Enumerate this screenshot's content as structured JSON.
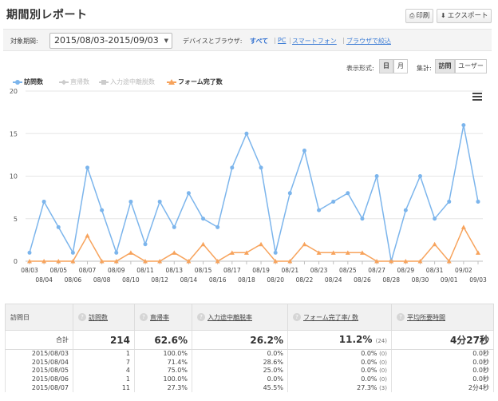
{
  "header": {
    "title": "期間別レポート",
    "print_label": "印刷",
    "export_label": "エクスポート"
  },
  "filter": {
    "period_label": "対象期間:",
    "period_value": "2015/08/03-2015/09/03",
    "device_label": "デバイスとブラウザ:",
    "device_links": [
      "すべて",
      "PC",
      "スマートフォン",
      "ブラウザで絞込"
    ],
    "device_active": "すべて"
  },
  "controls": {
    "display_label": "表示形式:",
    "display_options": [
      "日",
      "月"
    ],
    "display_active": "日",
    "aggregate_label": "集計:",
    "aggregate_options": [
      "訪問",
      "ユーザー"
    ],
    "aggregate_active": "訪問"
  },
  "colors": {
    "visits": "#7cb5ec",
    "form": "#f7a35c",
    "inactive": "#cccccc",
    "grid": "#e6e6e6",
    "link": "#3a7bd5"
  },
  "chart_data": {
    "type": "line",
    "ylim": [
      0,
      20
    ],
    "yticks": [
      0,
      5,
      10,
      15,
      20
    ],
    "x": [
      "08/03",
      "08/04",
      "08/05",
      "08/06",
      "08/07",
      "08/08",
      "08/09",
      "08/10",
      "08/11",
      "08/12",
      "08/13",
      "08/14",
      "08/15",
      "08/16",
      "08/17",
      "08/18",
      "08/19",
      "08/20",
      "08/21",
      "08/22",
      "08/23",
      "08/24",
      "08/25",
      "08/26",
      "08/27",
      "08/28",
      "08/29",
      "08/30",
      "08/31",
      "09/01",
      "09/02",
      "09/03"
    ],
    "series": [
      {
        "name": "訪問数",
        "visible": true,
        "values": [
          1,
          7,
          4,
          1,
          11,
          6,
          1,
          7,
          2,
          7,
          4,
          8,
          5,
          4,
          11,
          15,
          11,
          1,
          8,
          13,
          6,
          7,
          8,
          5,
          10,
          0,
          6,
          10,
          5,
          7,
          16,
          7
        ]
      },
      {
        "name": "直帰数",
        "visible": false,
        "values": []
      },
      {
        "name": "入力途中離脱数",
        "visible": false,
        "values": []
      },
      {
        "name": "フォーム完了数",
        "visible": true,
        "values": [
          0,
          0,
          0,
          0,
          3,
          0,
          0,
          1,
          0,
          0,
          1,
          0,
          2,
          0,
          1,
          1,
          2,
          0,
          0,
          2,
          1,
          1,
          1,
          1,
          0,
          0,
          0,
          0,
          2,
          0,
          4,
          1
        ]
      }
    ],
    "grid": true,
    "legend": "top-left"
  },
  "table": {
    "columns": [
      "訪問日",
      "訪問数",
      "直帰率",
      "入力途中離脱率",
      "フォーム完了率/ 数",
      "平均所要時間"
    ],
    "total": {
      "label": "合計",
      "visits": "214",
      "bounce": "62.6%",
      "abandon": "26.2%",
      "completion": "11.2%",
      "completion_count": "(24)",
      "avg_time": "4分27秒"
    },
    "rows": [
      {
        "date": "2015/08/03",
        "visits": "1",
        "bounce": "100.0%",
        "abandon": "0.0%",
        "completion": "0.0%",
        "completion_count": "(0)",
        "avg_time": "0.0秒"
      },
      {
        "date": "2015/08/04",
        "visits": "7",
        "bounce": "71.4%",
        "abandon": "28.6%",
        "completion": "0.0%",
        "completion_count": "(0)",
        "avg_time": "0.0秒"
      },
      {
        "date": "2015/08/05",
        "visits": "4",
        "bounce": "75.0%",
        "abandon": "25.0%",
        "completion": "0.0%",
        "completion_count": "(0)",
        "avg_time": "0.0秒"
      },
      {
        "date": "2015/08/06",
        "visits": "1",
        "bounce": "100.0%",
        "abandon": "0.0%",
        "completion": "0.0%",
        "completion_count": "(0)",
        "avg_time": "0.0秒"
      },
      {
        "date": "2015/08/07",
        "visits": "11",
        "bounce": "27.3%",
        "abandon": "45.5%",
        "completion": "27.3%",
        "completion_count": "(3)",
        "avg_time": "2分4秒"
      }
    ]
  }
}
